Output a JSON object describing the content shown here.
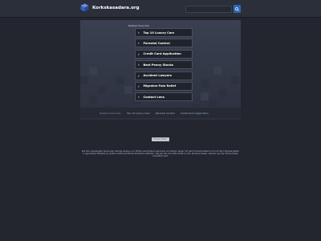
{
  "header": {
    "site_name": "Korkskasadara.org",
    "search_placeholder": ""
  },
  "hero": {
    "related_searches_title": "Related Searches",
    "links": [
      "Top 10 Luxury Cars",
      "Parental Control",
      "Credit Card Application",
      "Best Penny Stocks",
      "Accident Lawyers",
      "Migraine Pain Relief",
      "Contact Lens"
    ]
  },
  "bottom_bar": {
    "items": [
      "Related Searches:",
      "Top 10 Luxury Cars",
      "Parental Control",
      "Credit Card Application"
    ]
  },
  "footer": {
    "privacy_label": "Privacy Policy",
    "disclaimer": "Die hier angezeigten Sponsored Listings werden von Dritten automatisch generiert und stehen weder mit dem Domaininhaber noch mit dem Dienstanbieter in irgendeiner Beziehung. Sollten markenrechtliche Probleme auftreten, wenden Sie sich bitte direkt an den Domaininhaber, welcher aus den Whois-Daten ersichtlich wird."
  },
  "colors": {
    "page_bg": "#23252f",
    "topbar_bg": "#2b2f3a",
    "accent": "#2f67b5",
    "link_bg": "#1f232c"
  }
}
